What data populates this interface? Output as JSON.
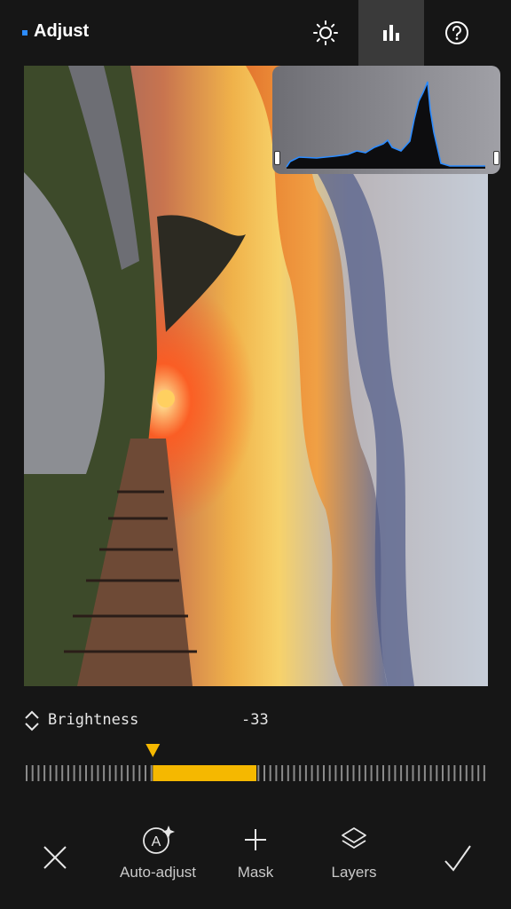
{
  "header": {
    "title": "Adjust"
  },
  "toolbar": {
    "icons": [
      "brightness-icon",
      "histogram-icon",
      "help-icon"
    ],
    "active": "histogram"
  },
  "adjustment": {
    "parameter": "Brightness",
    "value": "-33",
    "level": -0.33
  },
  "bottom_bar": {
    "cancel_icon": "close-icon",
    "auto_adjust_label": "Auto-adjust",
    "mask_label": "Mask",
    "layers_label": "Layers",
    "confirm_icon": "check-icon"
  },
  "colors": {
    "background": "#161616",
    "accent": "#f5b800",
    "title_dot": "#2d8cff",
    "histogram_line": "#2d8cff"
  }
}
